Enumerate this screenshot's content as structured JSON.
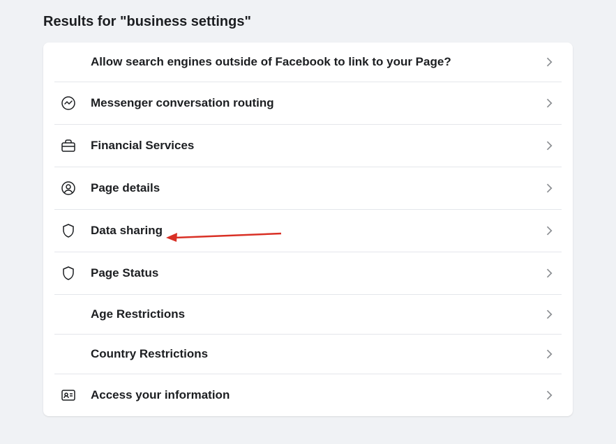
{
  "title": "Results for \"business settings\"",
  "rows": [
    {
      "label": "Allow search engines outside of Facebook to link to your Page?",
      "icon": null
    },
    {
      "label": "Messenger conversation routing",
      "icon": "messenger"
    },
    {
      "label": "Financial Services",
      "icon": "briefcase"
    },
    {
      "label": "Page details",
      "icon": "person-circle"
    },
    {
      "label": "Data sharing",
      "icon": "shield"
    },
    {
      "label": "Page Status",
      "icon": "shield"
    },
    {
      "label": "Age Restrictions",
      "icon": null
    },
    {
      "label": "Country Restrictions",
      "icon": null
    },
    {
      "label": "Access your information",
      "icon": "id-card"
    }
  ],
  "annotation": {
    "points_to_row_index": 4,
    "color": "#d93025"
  }
}
